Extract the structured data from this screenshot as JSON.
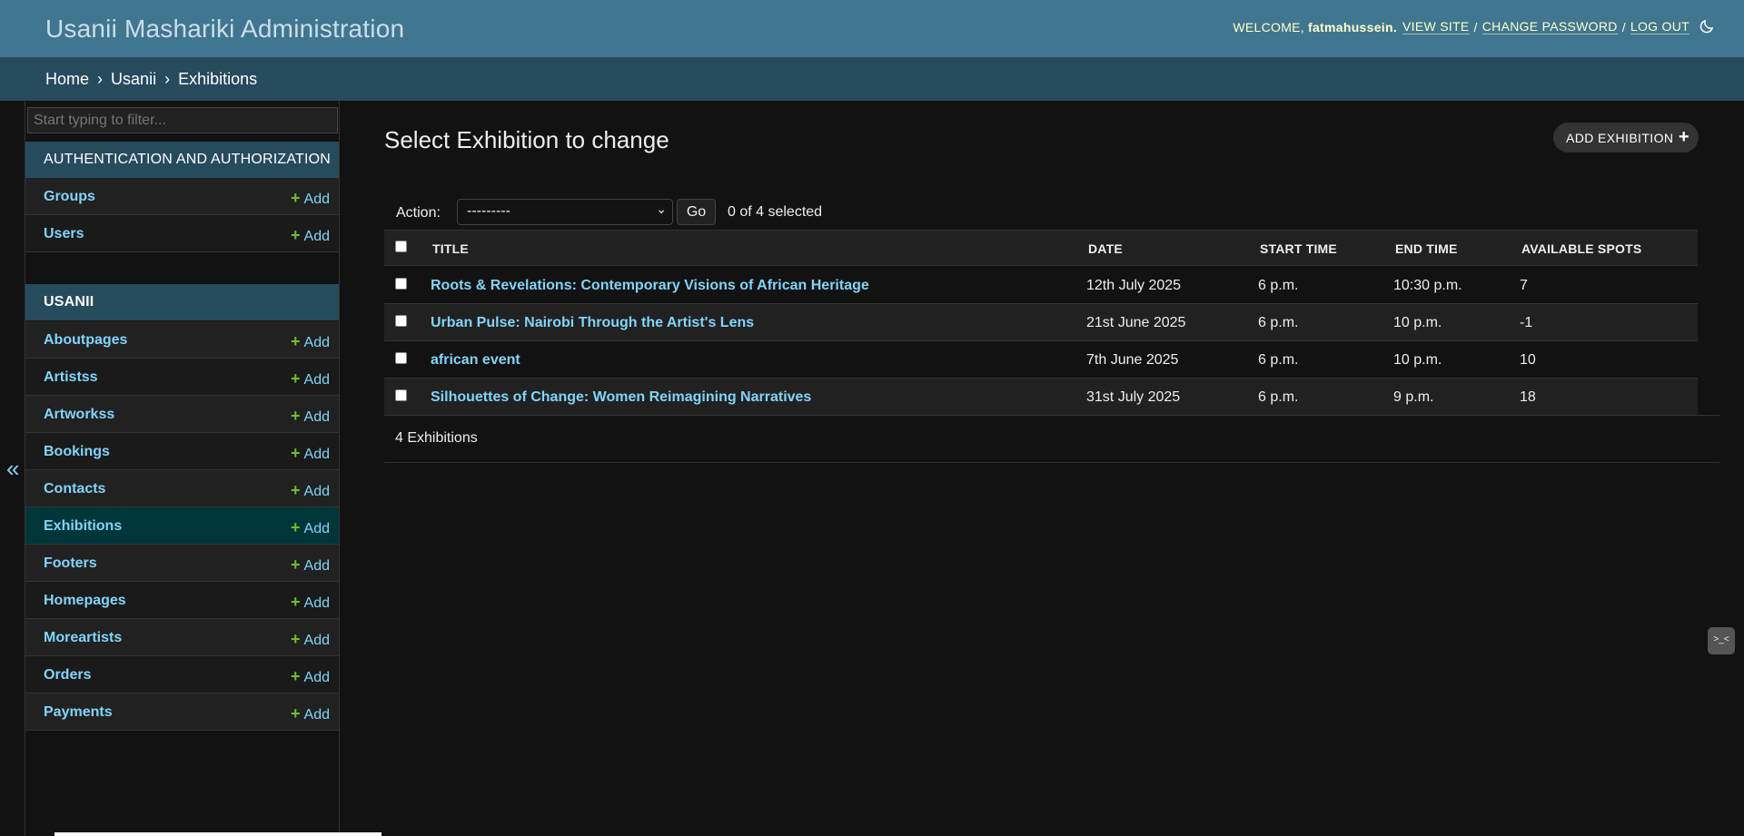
{
  "header": {
    "site_name": "Usanii Mashariki Administration",
    "welcome": "Welcome,",
    "username": "fatmahussein.",
    "view_site": "View site",
    "change_password": "Change password",
    "log_out": "Log out",
    "sep": "/",
    "theme_icon": "moon-icon"
  },
  "breadcrumbs": {
    "home": "Home",
    "app": "Usanii",
    "current": "Exhibitions",
    "sep": "›"
  },
  "sidebar": {
    "toggle": "«",
    "filter_placeholder": "Start typing to filter...",
    "modules": [
      {
        "caption": "Authentication and Authorization",
        "models": [
          {
            "name": "Groups",
            "add": "Add"
          },
          {
            "name": "Users",
            "add": "Add"
          }
        ]
      },
      {
        "caption": "Usanii",
        "models": [
          {
            "name": "Aboutpages",
            "add": "Add"
          },
          {
            "name": "Artistss",
            "add": "Add"
          },
          {
            "name": "Artworkss",
            "add": "Add"
          },
          {
            "name": "Bookings",
            "add": "Add"
          },
          {
            "name": "Contacts",
            "add": "Add"
          },
          {
            "name": "Exhibitions",
            "add": "Add"
          },
          {
            "name": "Footers",
            "add": "Add"
          },
          {
            "name": "Homepages",
            "add": "Add"
          },
          {
            "name": "Moreartists",
            "add": "Add"
          },
          {
            "name": "Orders",
            "add": "Add"
          },
          {
            "name": "Payments",
            "add": "Add"
          }
        ]
      }
    ]
  },
  "main": {
    "title": "Select Exhibition to change",
    "add_button": "Add Exhibition",
    "action_label": "Action:",
    "action_selected": "---------",
    "go": "Go",
    "selected_count": "0 of 4 selected",
    "columns": [
      "Title",
      "Date",
      "Start time",
      "End time",
      "Available spots"
    ],
    "rows": [
      {
        "title": "Roots & Revelations: Contemporary Visions of African Heritage",
        "date": "12th July 2025",
        "start": "6 p.m.",
        "end": "10:30 p.m.",
        "spots": "7"
      },
      {
        "title": "Urban Pulse: Nairobi Through the Artist's Lens",
        "date": "21st June 2025",
        "start": "6 p.m.",
        "end": "10 p.m.",
        "spots": "-1"
      },
      {
        "title": "african event",
        "date": "7th June 2025",
        "start": "6 p.m.",
        "end": "10 p.m.",
        "spots": "10"
      },
      {
        "title": "Silhouettes of Change: Women Reimagining Narratives",
        "date": "31st July 2025",
        "start": "6 p.m.",
        "end": "9 p.m.",
        "spots": "18"
      }
    ],
    "result_count": "4 Exhibitions"
  },
  "colors": {
    "header": "#417690",
    "breadcrumbs": "#264b5d",
    "link": "#81d4fa",
    "add_plus": "#70bf2b",
    "background": "#121212"
  }
}
